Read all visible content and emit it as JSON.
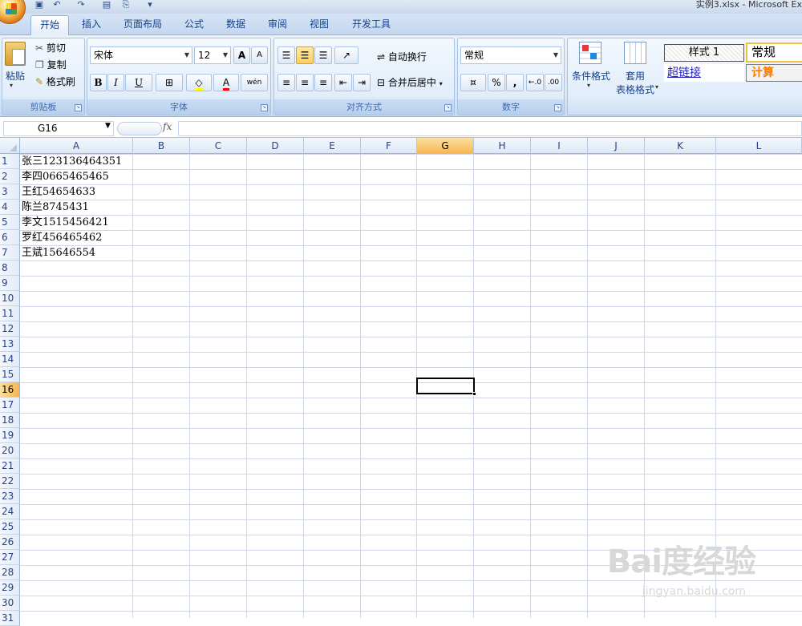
{
  "window": {
    "title": "实例3.xlsx - Microsoft Ex"
  },
  "qat": {
    "icons": [
      "save-icon",
      "undo-icon",
      "redo-icon",
      "print-preview-icon",
      "customize-icon"
    ]
  },
  "tabs": [
    "开始",
    "插入",
    "页面布局",
    "公式",
    "数据",
    "审阅",
    "视图",
    "开发工具"
  ],
  "active_tab": "开始",
  "clipboard": {
    "paste": "粘贴",
    "cut": "剪切",
    "copy": "复制",
    "format_painter": "格式刷",
    "label": "剪贴板"
  },
  "font": {
    "name": "宋体",
    "size": "12",
    "grow": "A",
    "shrink": "A",
    "bold": "B",
    "italic": "I",
    "underline": "U",
    "phonetic": "wén",
    "label": "字体"
  },
  "alignment": {
    "wrap": "自动换行",
    "merge": "合并后居中",
    "label": "对齐方式"
  },
  "number": {
    "format": "常规",
    "percent": "%",
    "comma": ",",
    "inc": "←.0",
    "dec": ".00",
    "label": "数字"
  },
  "styles": {
    "conditional": "条件格式",
    "table_format_1": "套用",
    "table_format_2": "表格格式",
    "style1": "样式 1",
    "normal": "常规",
    "hyperlink": "超链接",
    "calc": "计算"
  },
  "formula_bar": {
    "name_box": "G16",
    "fx": "fx",
    "value": ""
  },
  "columns": [
    "A",
    "B",
    "C",
    "D",
    "E",
    "F",
    "G",
    "H",
    "I",
    "J",
    "K",
    "L"
  ],
  "selected_column": "G",
  "rows": [
    "1",
    "2",
    "3",
    "4",
    "5",
    "6",
    "7",
    "8",
    "9",
    "10",
    "11",
    "12",
    "13",
    "14",
    "15",
    "16",
    "17",
    "18",
    "19",
    "20",
    "21",
    "22",
    "23",
    "24",
    "25",
    "26",
    "27",
    "28",
    "29",
    "30",
    "31"
  ],
  "selected_row": "16",
  "cells_A": [
    "张三123136464351",
    "李四0665465465",
    "王红54654633",
    "陈兰8745431",
    "李文1515456421",
    "罗红456465462",
    "王斌15646554"
  ],
  "watermark": {
    "main": "Bai度经验",
    "sub": "jingyan.baidu.com"
  }
}
